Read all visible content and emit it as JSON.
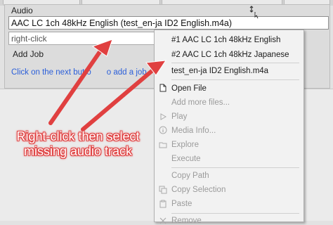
{
  "audio_section": {
    "label": "Audio",
    "selected_track": "AAC LC 1ch 48kHz English (test_en-ja ID2 English.m4a)",
    "input_value": "right-click"
  },
  "add_job": {
    "label": "Add Job",
    "hint": "Click on the next butto",
    "hint_tail": "o add a job."
  },
  "context_menu": {
    "track_1": "#1 AAC LC 1ch 48kHz English",
    "track_2": "#2 AAC LC 1ch 48kHz Japanese",
    "file_item": "test_en-ja ID2 English.m4a",
    "open_file": "Open File",
    "add_more_files": "Add more files...",
    "play": "Play",
    "media_info": "Media Info...",
    "explore": "Explore",
    "execute": "Execute",
    "copy_path": "Copy Path",
    "copy_selection": "Copy Selection",
    "paste": "Paste",
    "remove": "Remove"
  },
  "annotation": {
    "text": "Right-click then select missing audio track",
    "color": "#e04040"
  }
}
